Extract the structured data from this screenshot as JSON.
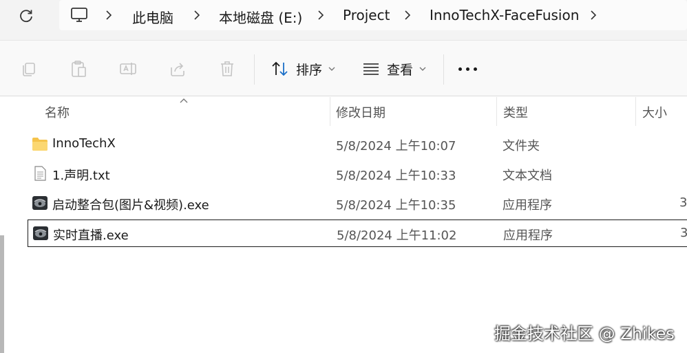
{
  "address_bar": {
    "crumbs": [
      "此电脑",
      "本地磁盘 (E:)",
      "Project",
      "InnoTechX-FaceFusion"
    ]
  },
  "toolbar": {
    "sort_label": "排序",
    "view_label": "查看"
  },
  "columns": {
    "name": "名称",
    "date": "修改日期",
    "type": "类型",
    "size": "大小"
  },
  "files": [
    {
      "name": "InnoTechX",
      "date": "5/8/2024 上午10:07",
      "type": "文件夹",
      "size": "",
      "icon": "folder-icon"
    },
    {
      "name": "1.声明.txt",
      "date": "5/8/2024 上午10:33",
      "type": "文本文档",
      "size": "",
      "icon": "text-file-icon"
    },
    {
      "name": "启动整合包(图片&视频).exe",
      "date": "5/8/2024 上午10:35",
      "type": "应用程序",
      "size": "3",
      "icon": "app-icon"
    },
    {
      "name": "实时直播.exe",
      "date": "5/8/2024 上午11:02",
      "type": "应用程序",
      "size": "3",
      "icon": "app-icon"
    }
  ],
  "watermark": "掘金技术社区 @ Zhikes",
  "colors": {
    "selection_border": "#1a1a1a",
    "folder": "#f5c34b"
  }
}
